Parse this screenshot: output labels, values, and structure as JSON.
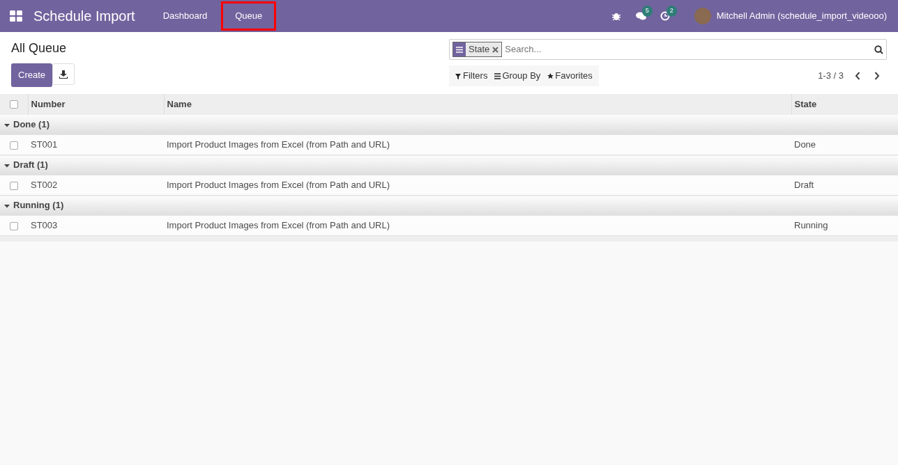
{
  "app": {
    "title": "Schedule Import"
  },
  "menu": [
    {
      "label": "Dashboard",
      "highlighted": false
    },
    {
      "label": "Queue",
      "highlighted": true
    }
  ],
  "systray": [
    {
      "kind": "bug"
    },
    {
      "kind": "chat",
      "badge": "5"
    },
    {
      "kind": "activity",
      "badge": "2"
    }
  ],
  "user": {
    "name": "Mitchell Admin (schedule_import_videooo)"
  },
  "breadcrumb": "All Queue",
  "buttons": {
    "create": "Create"
  },
  "search": {
    "facet": "State",
    "placeholder": "Search..."
  },
  "search_menus": [
    {
      "kind": "filter",
      "label": "Filters"
    },
    {
      "kind": "group",
      "label": "Group By"
    },
    {
      "kind": "favorite",
      "label": "Favorites"
    }
  ],
  "pager": "1-3 / 3",
  "table": {
    "all_checked": false,
    "columns": [
      "Number",
      "Name",
      "State"
    ],
    "groups": [
      {
        "label": "Done (1)",
        "expanded": true,
        "rows": [
          {
            "checked": false,
            "cells": [
              "ST001",
              "Import Product Images from Excel (from Path and URL)",
              "Done"
            ]
          }
        ]
      },
      {
        "label": "Draft (1)",
        "expanded": true,
        "rows": [
          {
            "checked": false,
            "cells": [
              "ST002",
              "Import Product Images from Excel (from Path and URL)",
              "Draft"
            ]
          }
        ]
      },
      {
        "label": "Running (1)",
        "expanded": true,
        "rows": [
          {
            "checked": false,
            "cells": [
              "ST003",
              "Import Product Images from Excel (from Path and URL)",
              "Running"
            ]
          }
        ]
      }
    ]
  }
}
